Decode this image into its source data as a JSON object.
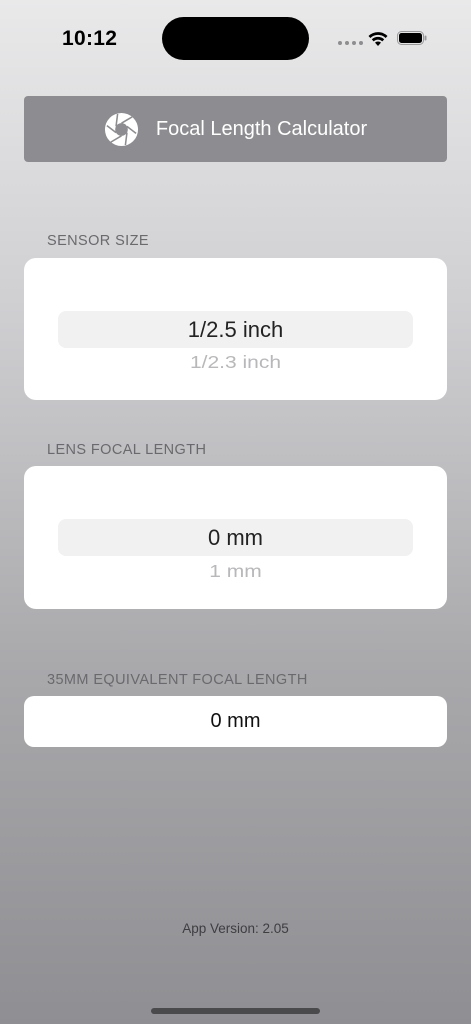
{
  "status_bar": {
    "time": "10:12"
  },
  "header": {
    "title": "Focal Length Calculator",
    "icon": "aperture-icon"
  },
  "sensor_size": {
    "label": "SENSOR SIZE",
    "selected": "1/2.5 inch",
    "next": "1/2.3 inch"
  },
  "lens_focal_length": {
    "label": "LENS FOCAL LENGTH",
    "selected": "0 mm",
    "next": "1 mm"
  },
  "equivalent": {
    "label": "35MM EQUIVALENT FOCAL LENGTH",
    "value": "0 mm"
  },
  "footer": {
    "version": "App Version: 2.05"
  },
  "colors": {
    "header_background": "#8d8d91",
    "card_background": "#ffffff",
    "picker_highlight": "#f1f1f2"
  }
}
